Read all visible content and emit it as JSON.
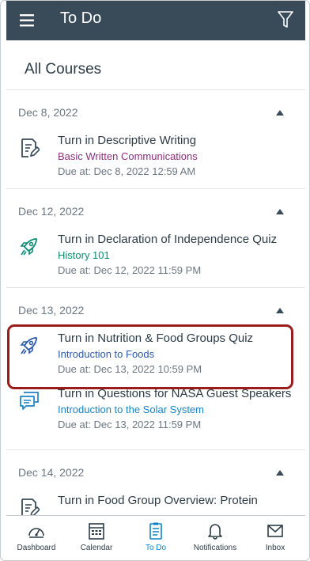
{
  "header": {
    "title": "To Do",
    "icon_menu": "hamburger-menu-icon",
    "icon_filter": "filter-icon",
    "bar_color": "#394b58"
  },
  "page": {
    "title": "All Courses"
  },
  "groups": [
    {
      "date": "Dec 8, 2022",
      "items": [
        {
          "icon": "assignment-icon",
          "title": "Turn in Descriptive Writing",
          "course": "Basic Written Communications",
          "course_color": "#8b2f7d",
          "due": "Due at: Dec 8, 2022 12:59 AM"
        }
      ]
    },
    {
      "date": "Dec 12, 2022",
      "items": [
        {
          "icon": "quiz-icon",
          "title": "Turn in Declaration of Independence Quiz",
          "course": "History 101",
          "course_color": "#0b8a73",
          "due": "Due at: Dec 12, 2022 11:59 PM"
        }
      ]
    },
    {
      "date": "Dec 13, 2022",
      "items": [
        {
          "icon": "quiz-icon",
          "title": "Turn in Nutrition & Food Groups Quiz",
          "course": "Introduction to Foods",
          "course_color": "#2d5aa8",
          "due": "Due at: Dec 13, 2022 10:59 PM"
        },
        {
          "icon": "discussion-icon",
          "title": "Turn in Questions for NASA Guest Speakers",
          "course": "Introduction to the Solar System",
          "course_color": "#1a82c4",
          "due": "Due at: Dec 13, 2022 11:59 PM"
        }
      ]
    },
    {
      "date": "Dec 14, 2022",
      "items": [
        {
          "icon": "assignment-icon",
          "title": "Turn in Food Group Overview: Protein",
          "course": "",
          "course_color": "#2d3b45",
          "due": ""
        }
      ]
    }
  ],
  "tabs": [
    {
      "label": "Dashboard",
      "icon": "dashboard-icon",
      "active": false
    },
    {
      "label": "Calendar",
      "icon": "calendar-icon",
      "active": false
    },
    {
      "label": "To Do",
      "icon": "todo-clipboard-icon",
      "active": true
    },
    {
      "label": "Notifications",
      "icon": "bell-icon",
      "active": false
    },
    {
      "label": "Inbox",
      "icon": "inbox-icon",
      "active": false
    }
  ],
  "accent_color": "#0b84c6",
  "highlight_color": "#9b1c1c"
}
